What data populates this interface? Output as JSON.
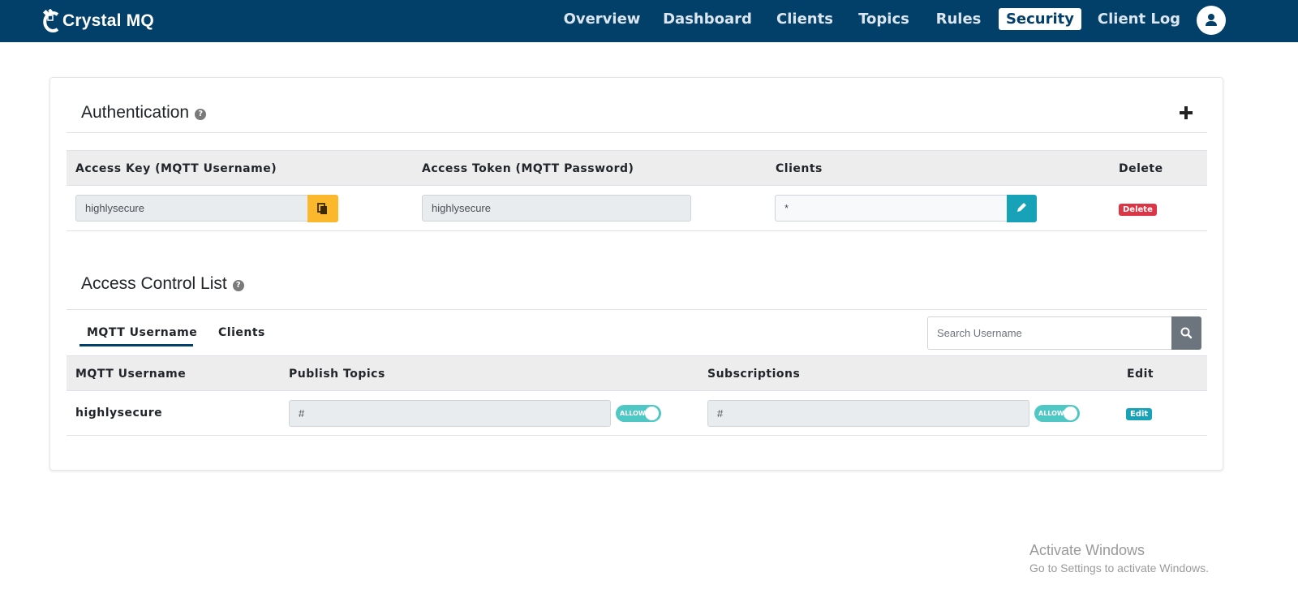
{
  "app": {
    "brand": "Crystal MQ"
  },
  "nav": {
    "items": [
      {
        "label": "Overview"
      },
      {
        "label": "Dashboard"
      },
      {
        "label": "Clients"
      },
      {
        "label": "Topics"
      },
      {
        "label": "Rules"
      },
      {
        "label": "Security",
        "active": true
      },
      {
        "label": "Client Log"
      }
    ],
    "avatar_icon": "user-icon"
  },
  "authentication": {
    "title": "Authentication",
    "columns": [
      "Access Key (MQTT Username)",
      "Access Token (MQTT Password)",
      "Clients",
      "Delete"
    ],
    "row": {
      "access_key": "highlysecure",
      "access_token": "highlysecure",
      "clients": "*",
      "delete_label": "Delete"
    }
  },
  "acl": {
    "title": "Access Control List",
    "tabs": [
      {
        "label": "MQTT Username",
        "active": true
      },
      {
        "label": "Clients"
      }
    ],
    "search_placeholder": "Search Username",
    "columns": [
      "MQTT Username",
      "Publish Topics",
      "Subscriptions",
      "Edit"
    ],
    "row": {
      "username": "highlysecure",
      "publish_topic": "#",
      "publish_toggle": "ALLOW",
      "subscription": "#",
      "subscription_toggle": "ALLOW",
      "edit_label": "Edit"
    }
  },
  "watermark": {
    "line1": "Activate Windows",
    "line2": "Go to Settings to activate Windows."
  },
  "colors": {
    "navbar": "#02406a",
    "copy_button": "#fcb82d",
    "pen_button": "#17a2b8",
    "delete_badge": "#dc3545",
    "toggle_on": "#4fc7c5"
  }
}
